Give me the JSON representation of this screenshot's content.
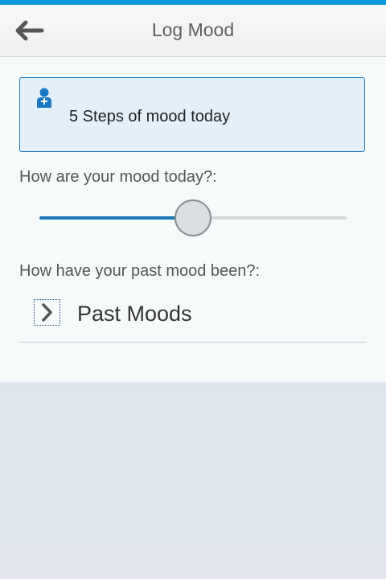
{
  "header": {
    "title": "Log Mood",
    "back_icon": "back-arrow-icon"
  },
  "info": {
    "icon": "user-icon",
    "text": "5 Steps of mood today"
  },
  "mood_today": {
    "label": "How are your mood today?:",
    "slider_value": 0.5
  },
  "past_mood": {
    "label": "How have your past mood been?:",
    "expander_icon": "chevron-right-icon",
    "expander_label": "Past Moods"
  },
  "colors": {
    "accent": "#0a9ad6",
    "primary": "#1a78b8",
    "info_bg": "#e3f0fa"
  }
}
